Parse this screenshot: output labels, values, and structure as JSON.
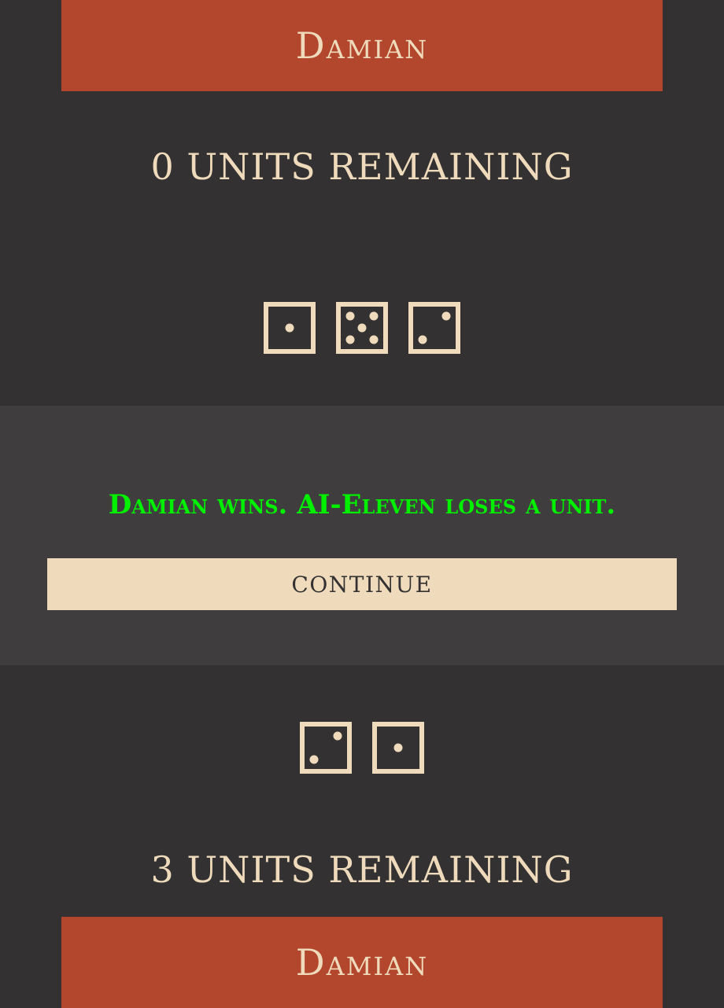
{
  "opponent": {
    "name": "Damian",
    "units_text": "0 UNITS REMAINING",
    "dice": [
      1,
      5,
      2
    ]
  },
  "result": {
    "message": "Damian wins. AI-Eleven loses a unit.",
    "continue_label": "CONTINUE"
  },
  "player": {
    "name": "Damian",
    "units_text": "3 UNITS REMAINING",
    "dice": [
      2,
      1
    ]
  },
  "colors": {
    "background": "#333132",
    "banner": "#b3472e",
    "cream": "#efdbbb",
    "panel": "#3f3d3e",
    "win_text": "#00f000"
  }
}
